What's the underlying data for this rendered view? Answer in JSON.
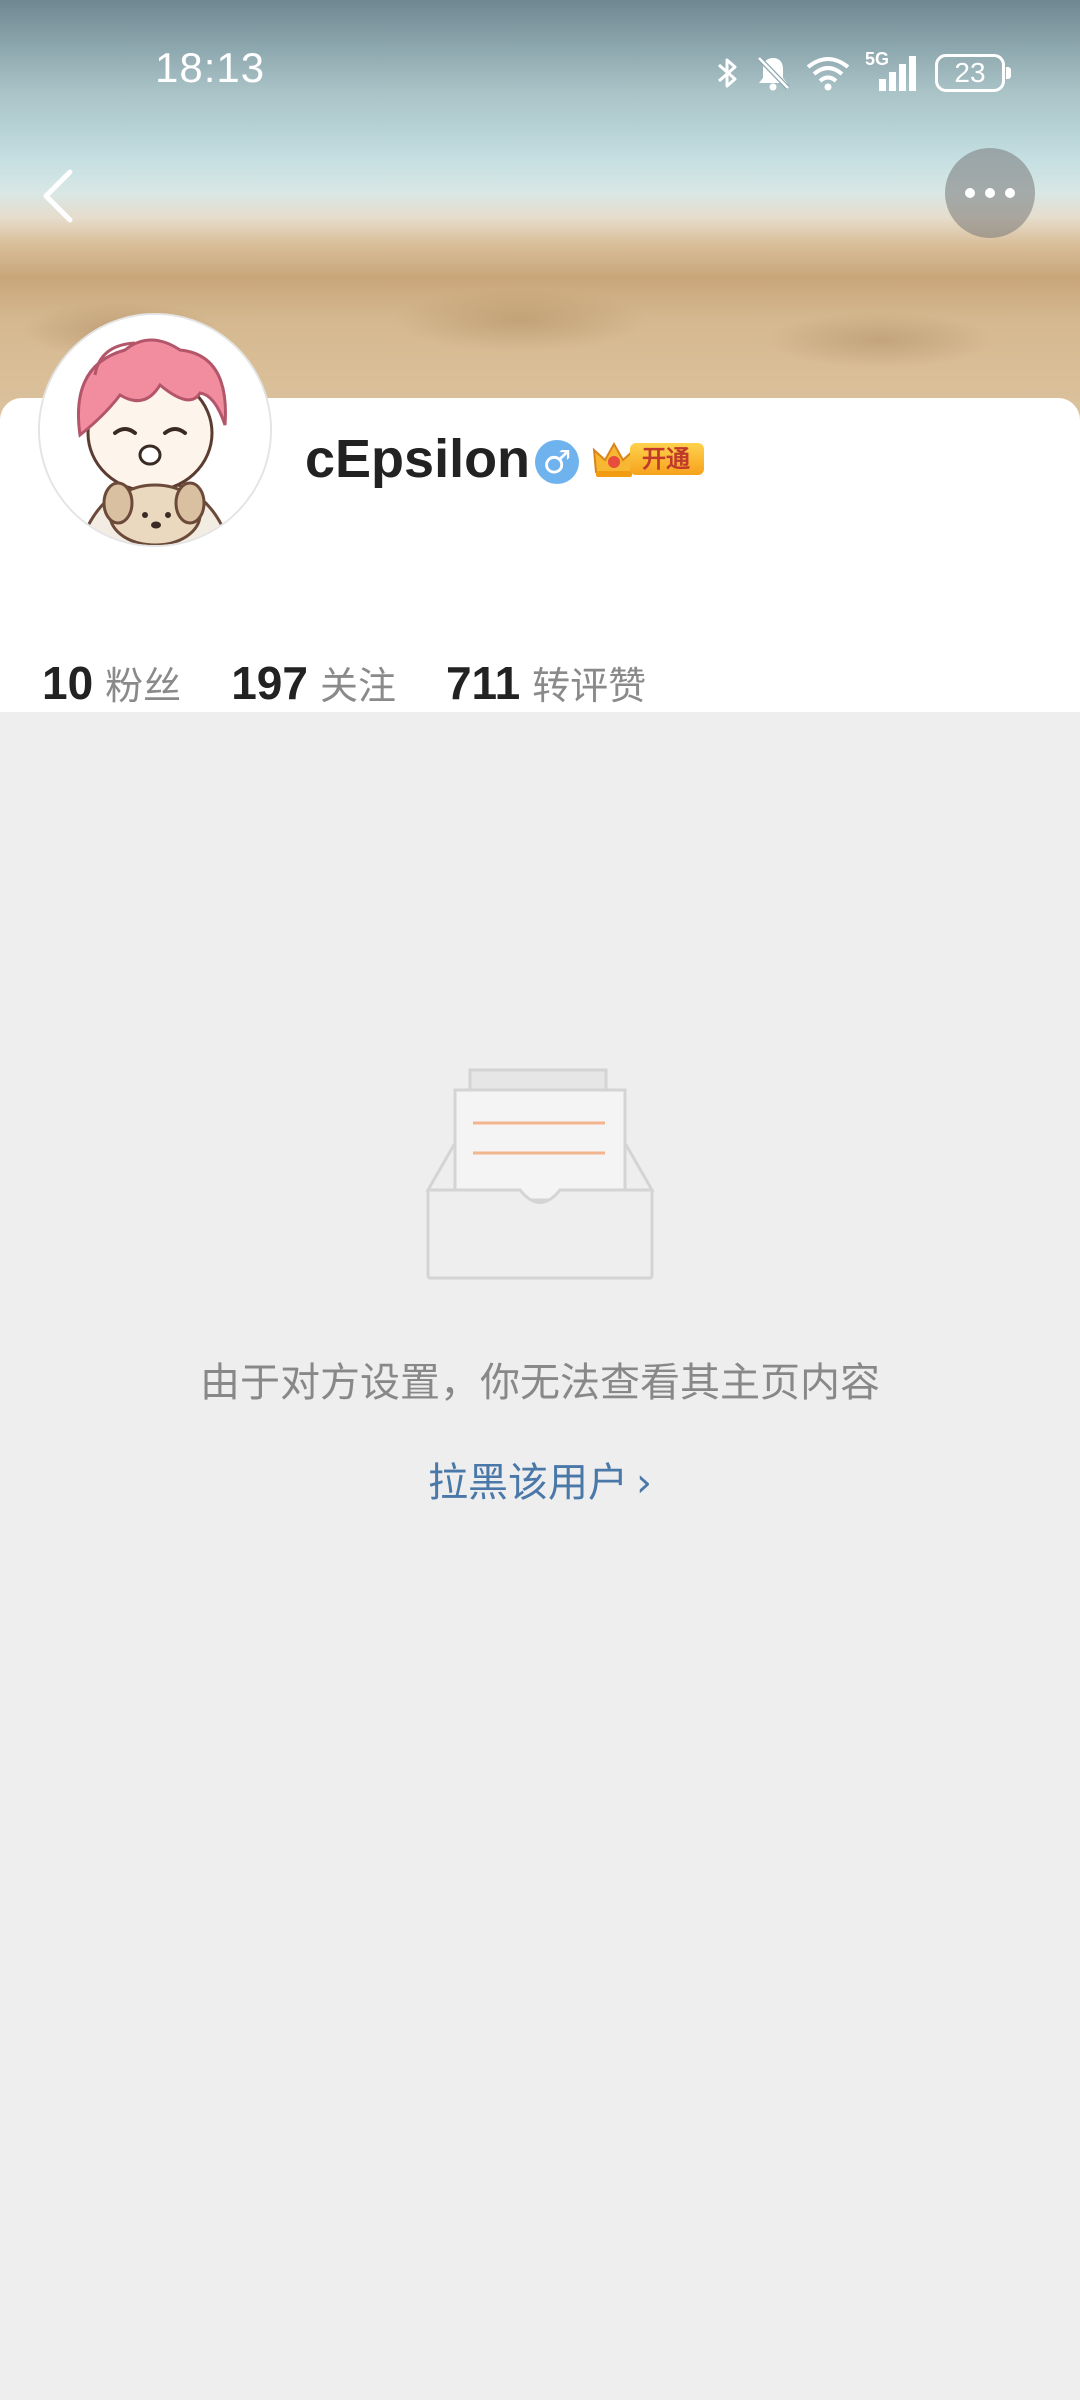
{
  "status_bar": {
    "time": "18:13",
    "network": "5G",
    "battery_level": "23"
  },
  "header": {
    "back_icon": "chevron-left-icon",
    "more_icon": "more-horizontal-icon"
  },
  "profile": {
    "username": "cEpsilon",
    "gender_symbol": "♂",
    "vip_label": "开通",
    "stats": [
      {
        "value": "10",
        "label": "粉丝"
      },
      {
        "value": "197",
        "label": "关注"
      },
      {
        "value": "711",
        "label": "转评赞"
      }
    ]
  },
  "empty_state": {
    "icon": "empty-inbox-icon",
    "message": "由于对方设置，你无法查看其主页内容",
    "action_label": "拉黑该用户",
    "action_chevron": "›"
  },
  "colors": {
    "link": "#4a78a8",
    "background": "#eeeeee",
    "gender_badge": "#6fb3ee",
    "vip_gold": "#f6a21c"
  }
}
